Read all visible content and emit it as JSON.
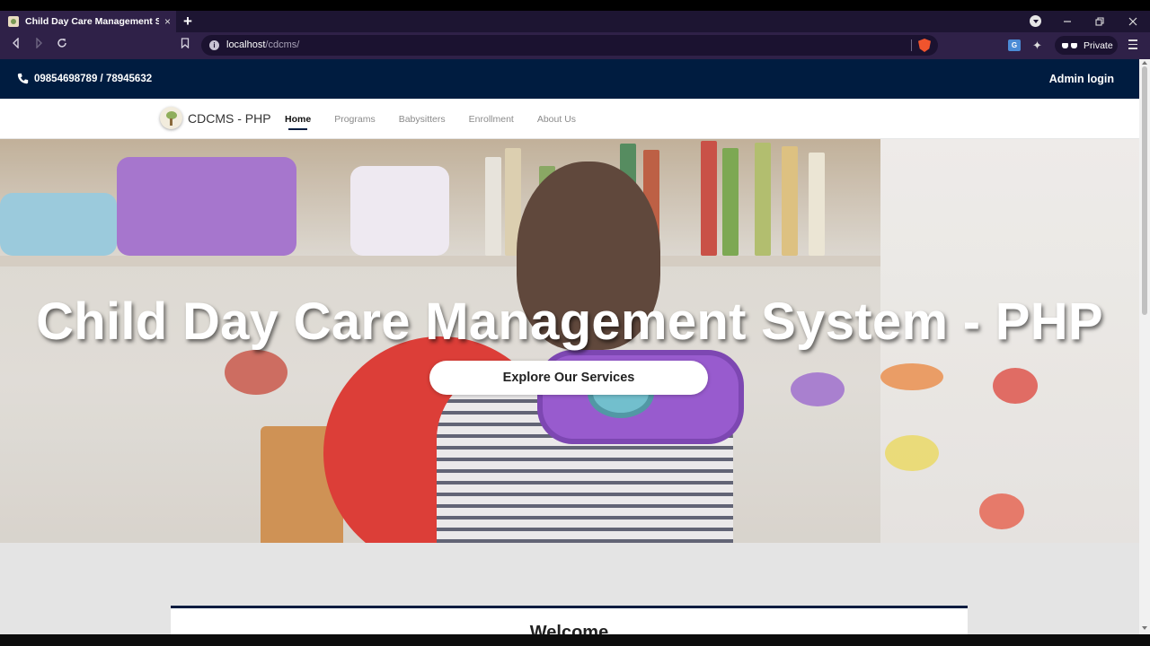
{
  "browser": {
    "tab_title": "Child Day Care Management Syst",
    "tab_close": "×",
    "new_tab": "+",
    "url_host": "localhost",
    "url_path": "/cdcms/",
    "private_label": "Private"
  },
  "site": {
    "topbar": {
      "phone": "09854698789 / 78945632",
      "admin_login": "Admin login"
    },
    "brand": "CDCMS - PHP",
    "nav": [
      {
        "label": "Home",
        "active": true
      },
      {
        "label": "Programs"
      },
      {
        "label": "Babysitters"
      },
      {
        "label": "Enrollment"
      },
      {
        "label": "About Us"
      }
    ],
    "hero": {
      "title": "Child Day Care Management System - PHP",
      "cta": "Explore Our Services"
    },
    "welcome": {
      "title": "Welcome"
    }
  },
  "colors": {
    "browser_dark": "#1d1532",
    "browser_toolbar": "#2f2148",
    "topbar": "#001c40",
    "brave": "#f0542d"
  }
}
